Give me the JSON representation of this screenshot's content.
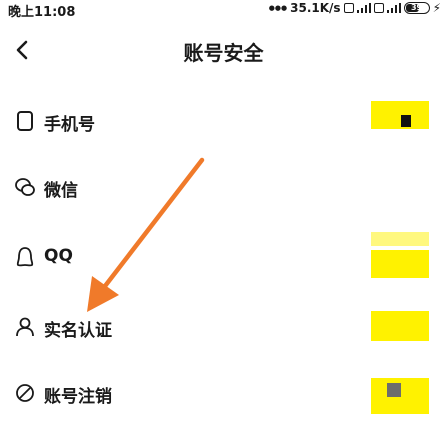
{
  "status_bar": {
    "time": "晚上11:08",
    "network_speed": "35.1K/s",
    "battery": "39"
  },
  "header": {
    "title": "账号安全"
  },
  "list": {
    "items": [
      {
        "label": "手机号",
        "icon": "phone-icon"
      },
      {
        "label": "微信",
        "icon": "wechat-icon"
      },
      {
        "label": "QQ",
        "icon": "qq-icon"
      },
      {
        "label": "实名认证",
        "icon": "user-icon"
      },
      {
        "label": "账号注销",
        "icon": "cancel-icon"
      }
    ]
  },
  "colors": {
    "highlight": "#fff200",
    "arrow": "#f07a2a"
  }
}
